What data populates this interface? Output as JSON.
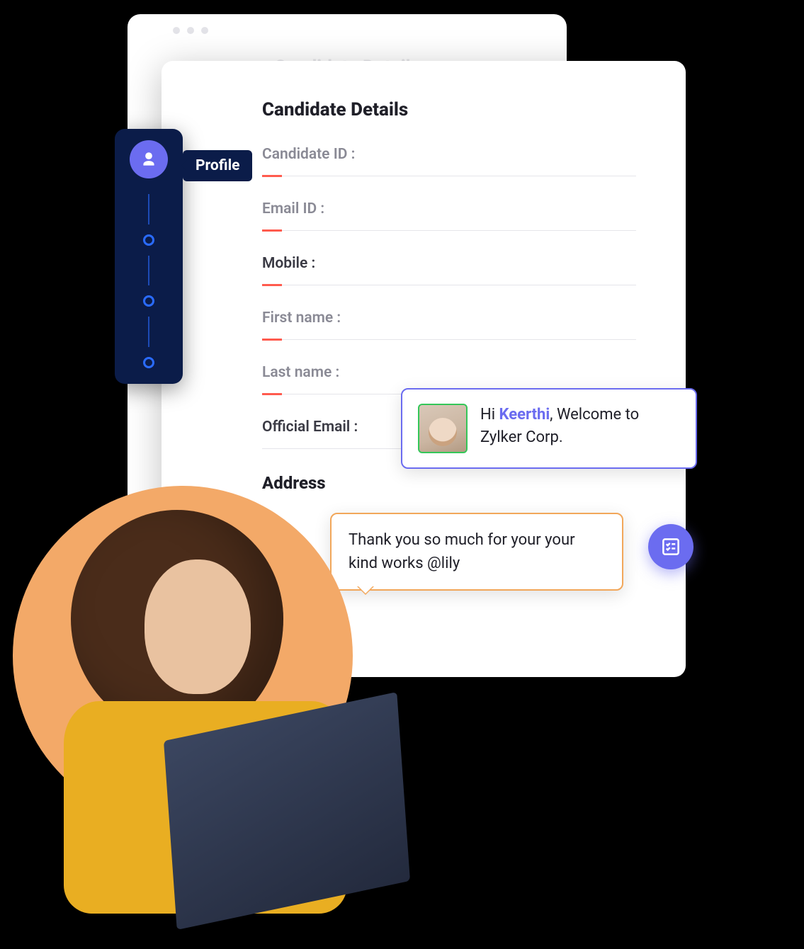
{
  "back_card": {
    "faded_title": "Candidate Details"
  },
  "wizard": {
    "active_label": "Profile"
  },
  "form": {
    "title": "Candidate Details",
    "fields": {
      "candidate_id": {
        "label": "Candidate ID :"
      },
      "email_id": {
        "label": "Email ID :"
      },
      "mobile": {
        "label": "Mobile :"
      },
      "first_name": {
        "label": "First name :"
      },
      "last_name": {
        "label": "Last name :"
      },
      "official_email": {
        "label": "Official Email :"
      }
    },
    "section_address": "Address"
  },
  "chat": {
    "bubble1": {
      "greeting_prefix": "Hi ",
      "highlight_name": "Keerthi",
      "greeting_suffix": ", Welcome to Zylker Corp."
    },
    "bubble2": {
      "text": "Thank you so much for your your kind works @lily"
    }
  }
}
